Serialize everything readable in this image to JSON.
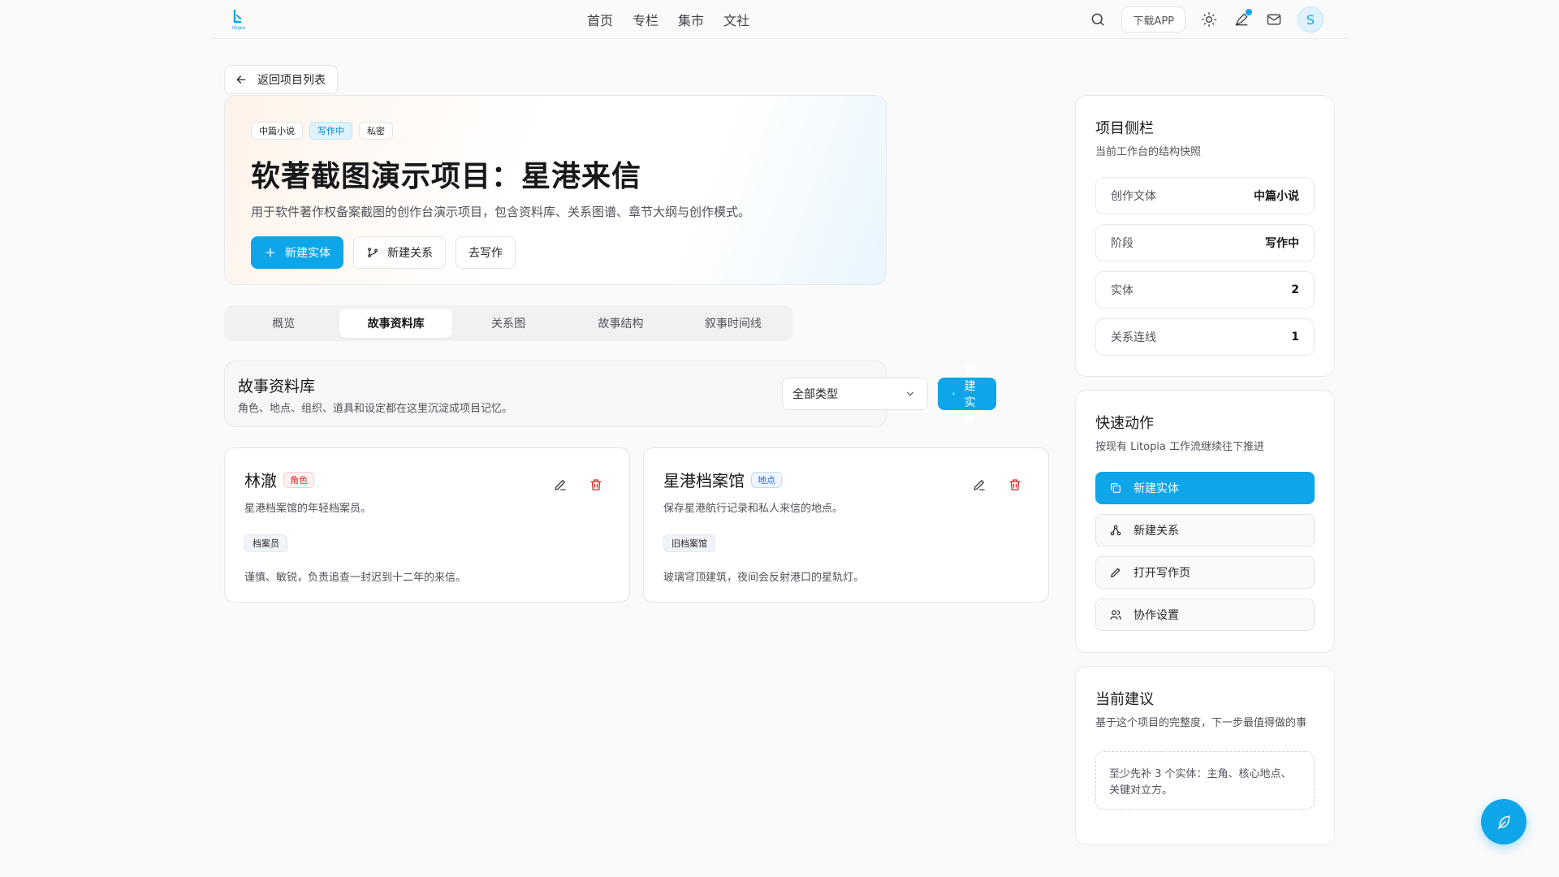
{
  "nav": {
    "logo_text": "litopia",
    "links": [
      "首页",
      "专栏",
      "集市",
      "文社"
    ],
    "download_label": "下载APP",
    "avatar_initial": "S"
  },
  "back_label": "返回项目列表",
  "hero": {
    "tags": [
      "中篇小说",
      "写作中",
      "私密"
    ],
    "title": "软著截图演示项目：星港来信",
    "description": "用于软件著作权备案截图的创作台演示项目，包含资料库、关系图谱、章节大纲与创作模式。",
    "actions": {
      "new_entity": "新建实体",
      "new_relation": "新建关系",
      "go_write": "去写作"
    }
  },
  "tabs": [
    "概览",
    "故事资料库",
    "关系图",
    "故事结构",
    "叙事时间线"
  ],
  "active_tab": 1,
  "library": {
    "title": "故事资料库",
    "description": "角色、地点、组织、道具和设定都在这里沉淀成项目记忆。",
    "filter_value": "全部类型",
    "new_entity_label": "新建实体"
  },
  "entities": [
    {
      "name": "林澈",
      "type": "角色",
      "description": "星港档案馆的年轻档案员。",
      "tag": "档案员",
      "note": "谨慎、敏锐，负责追查一封迟到十二年的来信。"
    },
    {
      "name": "星港档案馆",
      "type": "地点",
      "description": "保存星港航行记录和私人来信的地点。",
      "tag": "旧档案馆",
      "note": "玻璃穹顶建筑，夜间会反射港口的星轨灯。"
    }
  ],
  "sidebar": {
    "title": "项目侧栏",
    "subtitle": "当前工作台的结构快照",
    "stats": [
      {
        "label": "创作文体",
        "value": "中篇小说"
      },
      {
        "label": "阶段",
        "value": "写作中"
      },
      {
        "label": "实体",
        "value": "2"
      },
      {
        "label": "关系连线",
        "value": "1"
      }
    ]
  },
  "quick_actions": {
    "title": "快速动作",
    "subtitle": "按现有 Litopia 工作流继续往下推进",
    "items": [
      "新建实体",
      "新建关系",
      "打开写作页",
      "协作设置"
    ]
  },
  "suggestions": {
    "title": "当前建议",
    "subtitle": "基于这个项目的完整度，下一步最值得做的事",
    "tip": "至少先补 3 个实体：主角、核心地点、关键对立方。"
  },
  "colors": {
    "accent": "#0ea5e9",
    "danger": "#dc2626"
  }
}
